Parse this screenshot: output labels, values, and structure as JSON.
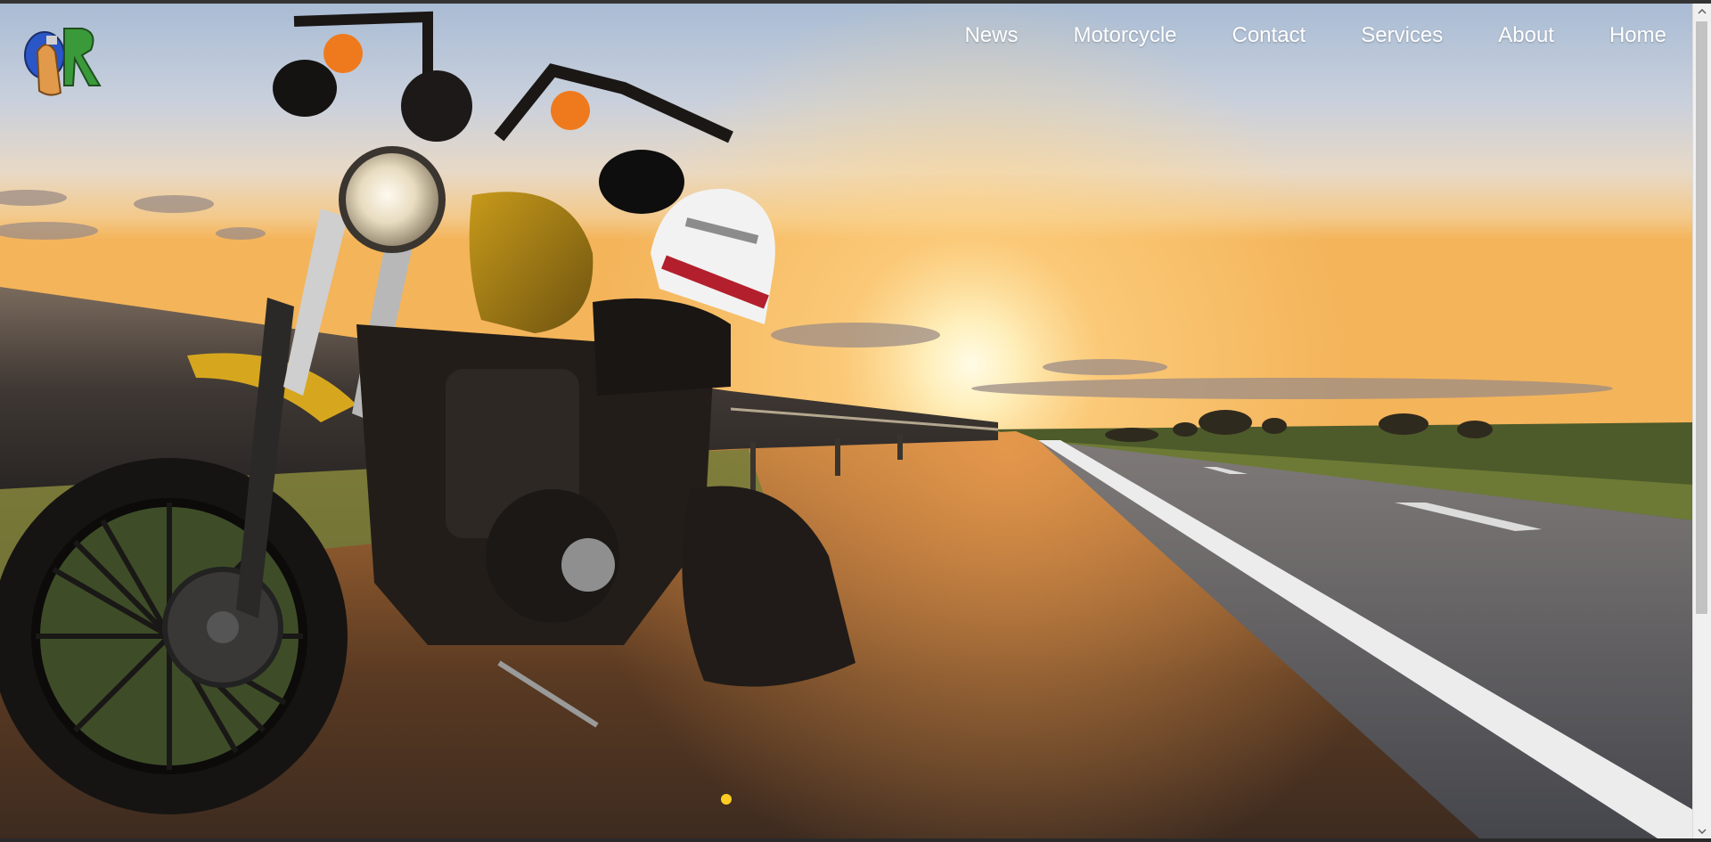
{
  "nav": {
    "items": [
      {
        "label": "News"
      },
      {
        "label": "Motorcycle"
      },
      {
        "label": "Contact"
      },
      {
        "label": "Services"
      },
      {
        "label": "About"
      },
      {
        "label": "Home"
      }
    ]
  },
  "logo": {
    "icon": "brand-logo-icon"
  },
  "hero": {
    "subject": "motorcycle-sunset-photo"
  },
  "colors": {
    "nav_text": "#ffffff",
    "sky_top": "#a9bcd4",
    "sun": "#fff6c8"
  }
}
